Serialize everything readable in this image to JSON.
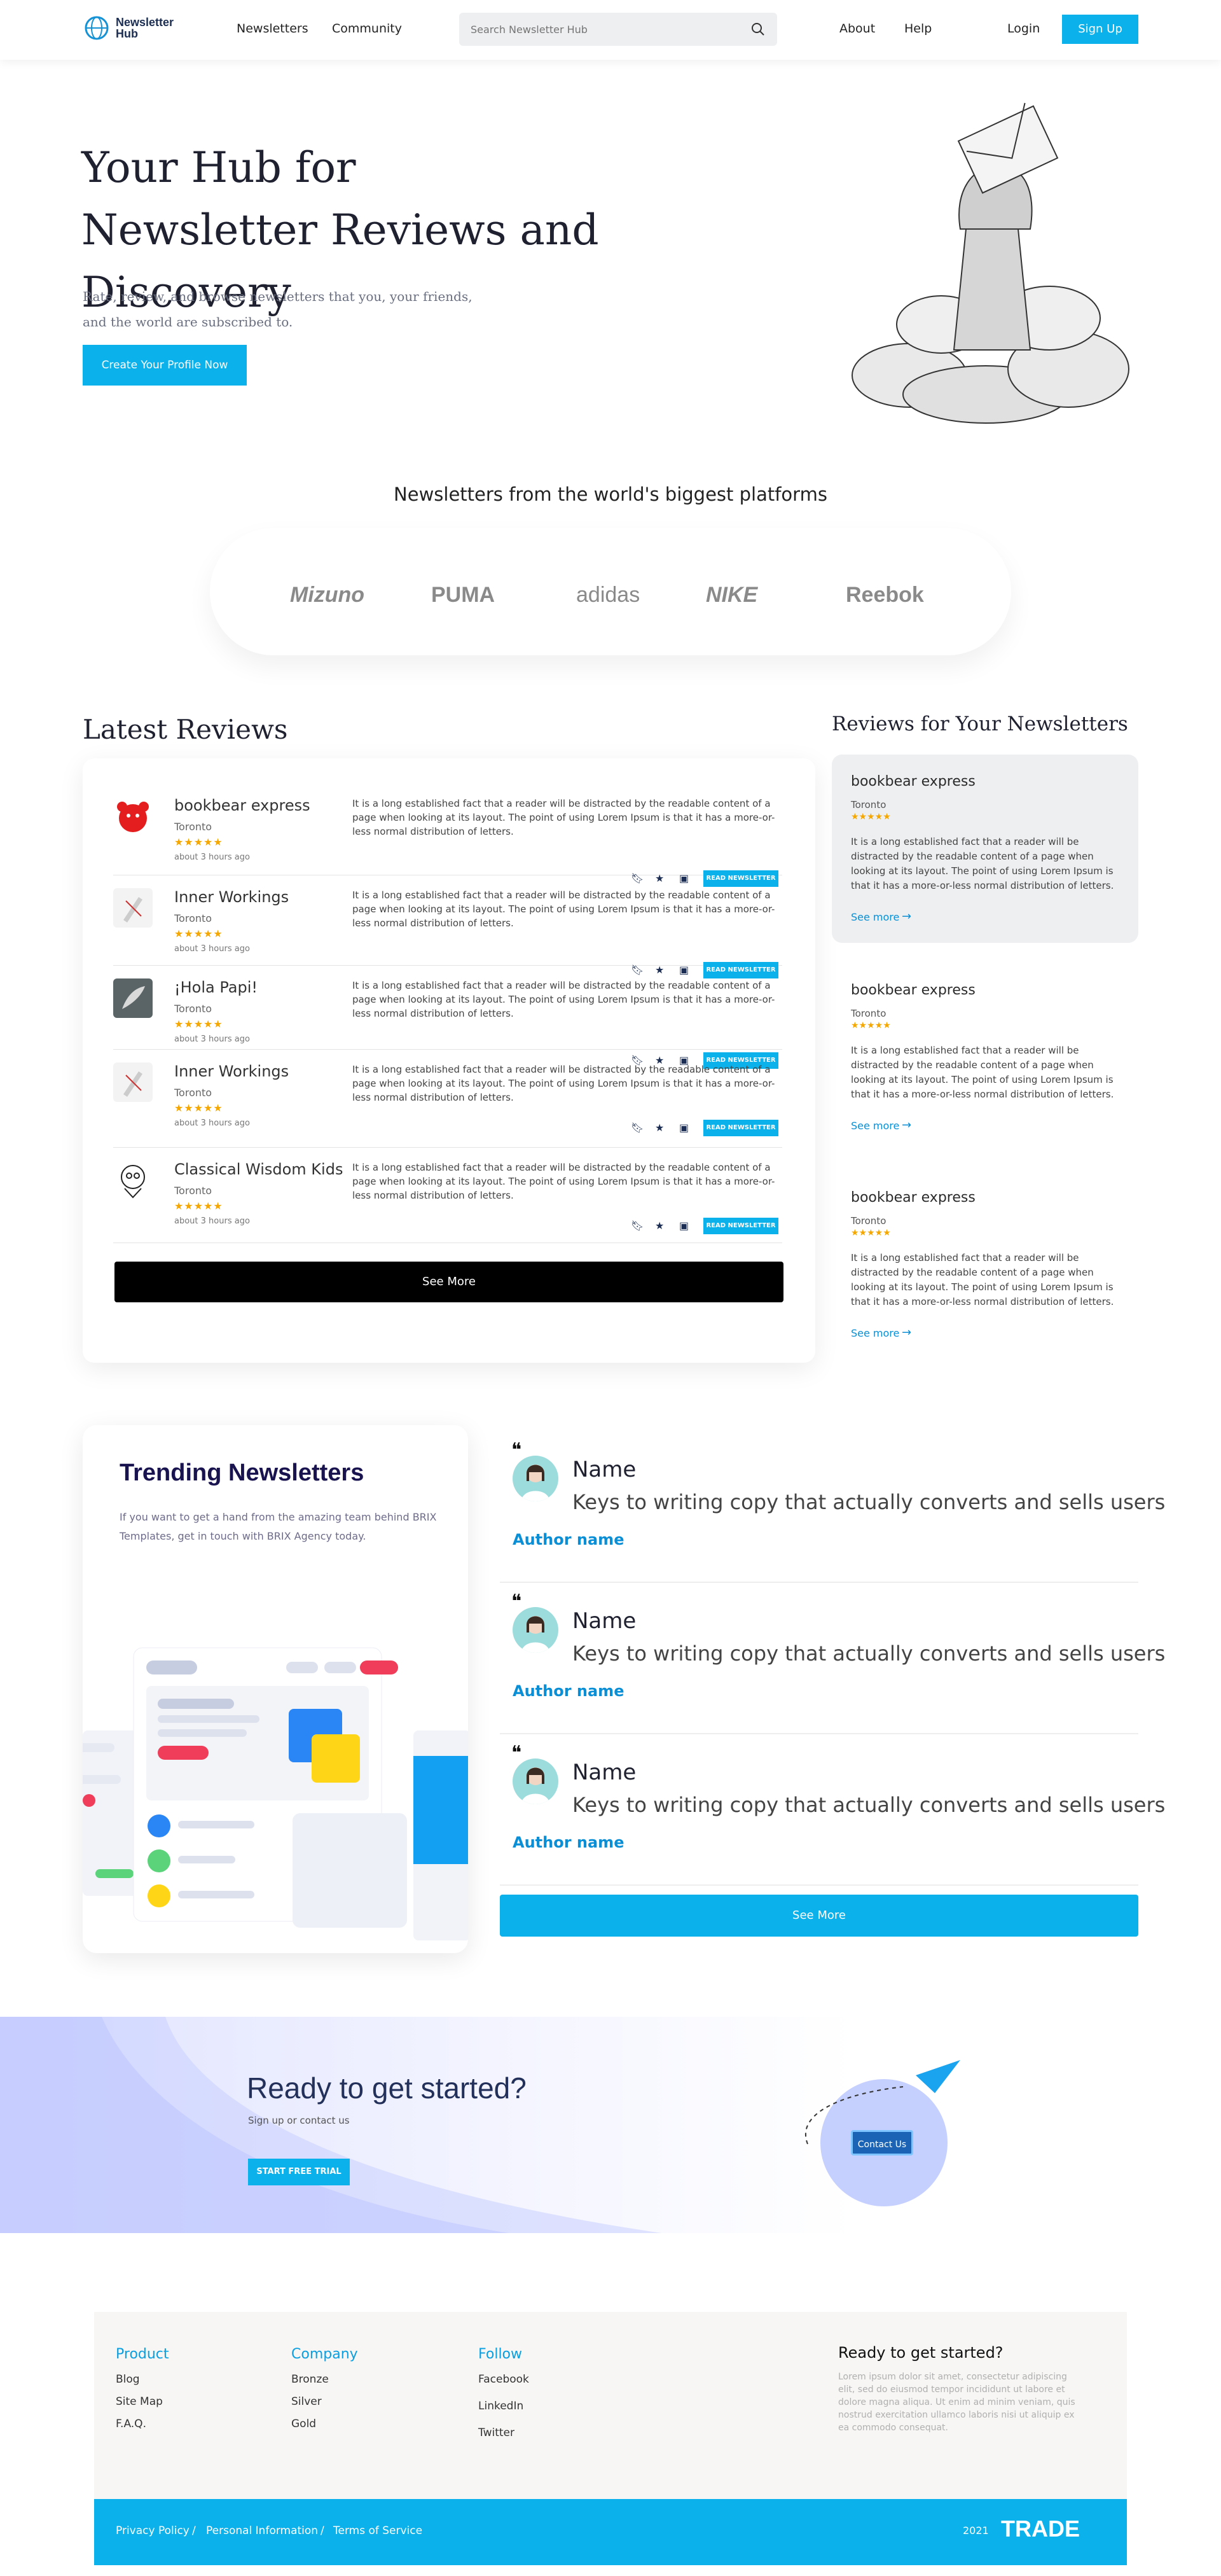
{
  "header": {
    "logo_line1": "Newsletter",
    "logo_line2": "Hub",
    "nav": [
      "Newsletters",
      "Community",
      "About",
      "Help",
      "Login"
    ],
    "search_placeholder": "Search Newsletter Hub",
    "signup": "Sign Up"
  },
  "hero": {
    "title": "Your Hub for Newsletter Reviews and Discovery",
    "subtitle": "Rate, review, and browse newsletters that you, your friends, and the world are subscribed to.",
    "cta": "Create Your Profile Now"
  },
  "platforms": {
    "title": "Newsletters from the world's biggest platforms",
    "brands": [
      "Mizuno",
      "PUMA",
      "adidas",
      "NIKE",
      "Reebok"
    ]
  },
  "latest_reviews": {
    "title": "Latest Reviews",
    "items": [
      {
        "name": "bookbear express",
        "location": "Toronto",
        "stars": "★★★★★",
        "time": "about 3 hours ago",
        "text": "It is a long established fact that a reader will be distracted by the readable content of a page when looking at its layout. The point of using Lorem Ipsum is that it has a more-or-less normal distribution of letters.",
        "action": "READ NEWSLETTER"
      },
      {
        "name": "Inner Workings",
        "location": "Toronto",
        "stars": "★★★★★",
        "time": "about 3 hours ago",
        "text": "It is a long established fact that a reader will be distracted by the readable content of a page when looking at its layout. The point of using Lorem Ipsum is that it has a more-or-less normal distribution of letters.",
        "action": "READ NEWSLETTER"
      },
      {
        "name": "¡Hola Papi!",
        "location": "Toronto",
        "stars": "★★★★★",
        "time": "about 3 hours ago",
        "text": "It is a long established fact that a reader will be distracted by the readable content of a page when looking at its layout. The point of using Lorem Ipsum is that it has a more-or-less normal distribution of letters.",
        "action": "READ NEWSLETTER"
      },
      {
        "name": "Inner Workings",
        "location": "Toronto",
        "stars": "★★★★★",
        "time": "about 3 hours ago",
        "text": "It is a long established fact that a reader will be distracted by the readable content of a page when looking at its layout. The point of using Lorem Ipsum is that it has a more-or-less normal distribution of letters.",
        "action": "READ NEWSLETTER"
      },
      {
        "name": "Classical Wisdom Kids",
        "location": "Toronto",
        "stars": "★★★★★",
        "time": "about 3 hours ago",
        "text": "It is a long established fact that a reader will be distracted by the readable content of a page when looking at its layout. The point of using Lorem Ipsum is that it has a more-or-less normal distribution of letters.",
        "action": "READ NEWSLETTER"
      }
    ],
    "see_more": "See More"
  },
  "your_reviews": {
    "title": "Reviews for Your Newsletters",
    "items": [
      {
        "name": "bookbear express",
        "location": "Toronto",
        "stars": "★★★★★",
        "text": "It is a long established fact that a reader will be distracted by the readable content of a page when looking at its layout. The point of using Lorem Ipsum is that it has a more-or-less normal distribution of letters.",
        "more": "See more"
      },
      {
        "name": "bookbear express",
        "location": "Toronto",
        "stars": "★★★★★",
        "text": "It is a long established fact that a reader will be distracted by the readable content of a page when looking at its layout. The point of using Lorem Ipsum is that it has a more-or-less normal distribution of letters.",
        "more": "See more"
      },
      {
        "name": "bookbear express",
        "location": "Toronto",
        "stars": "★★★★★",
        "text": "It is a long established fact that a reader will be distracted by the readable content of a page when looking at its layout. The point of using Lorem Ipsum is that it has a more-or-less normal distribution of letters.",
        "more": "See more"
      }
    ]
  },
  "trending": {
    "title": "Trending Newsletters",
    "subtitle": "If you want to get a hand from the amazing team behind BRIX Templates, get in touch with BRIX Agency today.",
    "testimonials": [
      {
        "name": "Name",
        "text": "Keys to writing copy that actually converts and sells users",
        "author": "Author name"
      },
      {
        "name": "Name",
        "text": "Keys to writing copy that actually converts and sells users",
        "author": "Author name"
      },
      {
        "name": "Name",
        "text": "Keys to writing copy that actually converts and sells users",
        "author": "Author name"
      }
    ],
    "see_more": "See More"
  },
  "cta": {
    "title": "Ready to get started?",
    "subtitle": "Sign up or contact us",
    "button": "START FREE TRIAL",
    "contact": "Contact Us"
  },
  "footer": {
    "columns": [
      {
        "heading": "Product",
        "links": [
          "Blog",
          "Site Map",
          "F.A.Q."
        ]
      },
      {
        "heading": "Company",
        "links": [
          "Bronze",
          "Silver",
          "Gold"
        ]
      },
      {
        "heading": "Follow",
        "links": [
          "Facebook",
          "LinkedIn",
          "Twitter"
        ]
      }
    ],
    "ready_title": "Ready to get started?",
    "ready_text": "Lorem ipsum dolor sit amet, consectetur adipiscing elit, sed do eiusmod tempor incididunt ut labore et dolore magna aliqua. Ut enim ad minim veniam, quis nostrud exercitation ullamco laboris nisi ut aliquip ex ea commodo consequat.",
    "bottom_links": [
      "Privacy Policy",
      "/",
      "Personal Information",
      "/",
      "Terms of Service"
    ],
    "year": "2021",
    "brand": "TRADE"
  },
  "colors": {
    "accent": "#0ab1ea",
    "dark": "#1f2130",
    "star": "#f5a700"
  }
}
